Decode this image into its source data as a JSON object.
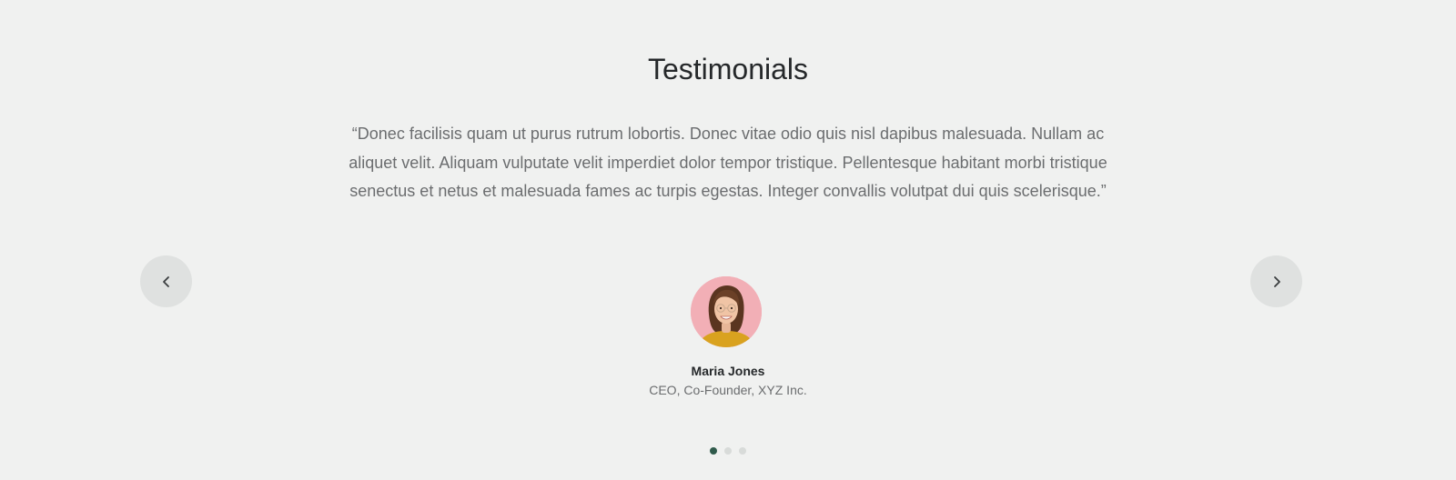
{
  "section": {
    "title": "Testimonials"
  },
  "testimonial": {
    "quote": "“Donec facilisis quam ut purus rutrum lobortis. Donec vitae odio quis nisl dapibus malesuada. Nullam ac aliquet velit. Aliquam vulputate velit imperdiet dolor tempor tristique. Pellentesque habitant morbi tristique senectus et netus et malesuada fames ac turpis egestas. Integer convallis volutpat dui quis scelerisque.”",
    "name": "Maria Jones",
    "role": "CEO, Co-Founder, XYZ Inc."
  },
  "carousel": {
    "prev_icon": "chevron-left-icon",
    "next_icon": "chevron-right-icon",
    "slide_count": 3,
    "active_index": 0
  },
  "colors": {
    "background": "#f0f1f0",
    "heading": "#25282a",
    "body_text": "#6b6d6f",
    "nav_button": "#dfe1e0",
    "dot_active": "#2f5a4b",
    "dot_inactive": "#d8dbd9",
    "avatar_bg": "#f2afb6"
  }
}
